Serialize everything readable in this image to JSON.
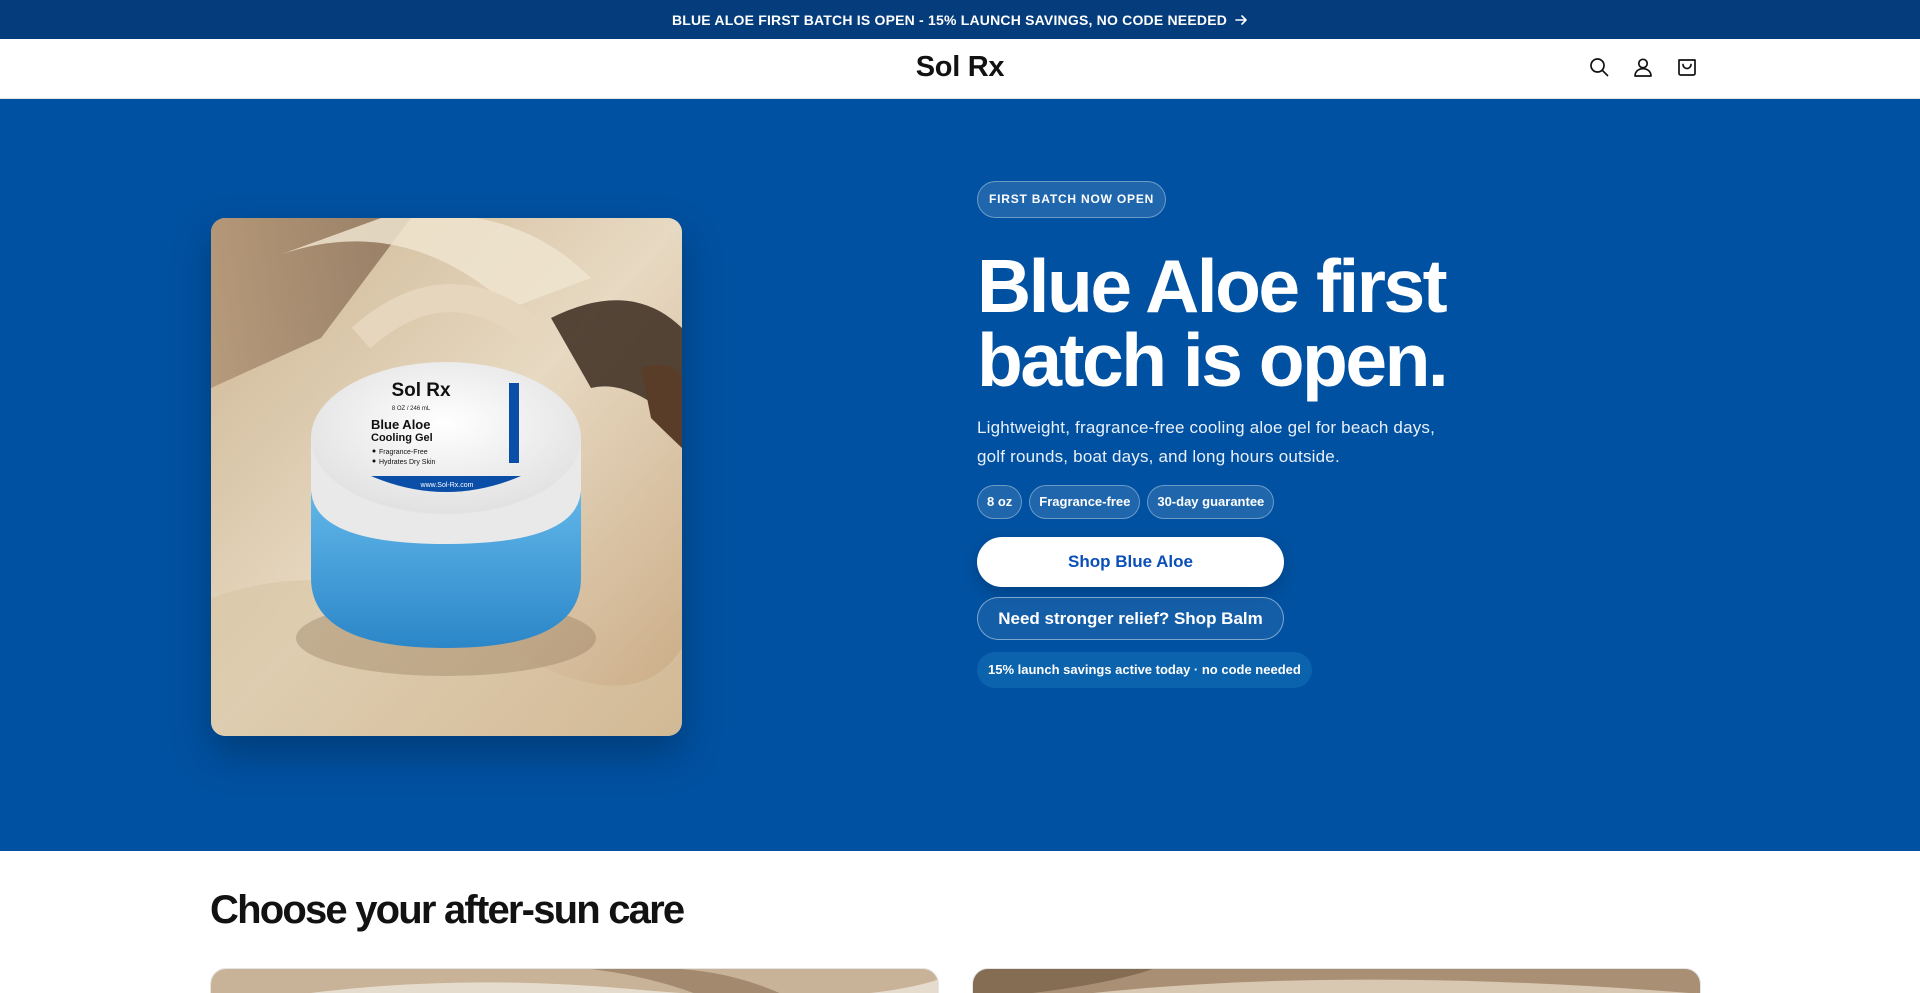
{
  "announcement": {
    "text": "BLUE ALOE FIRST BATCH IS OPEN - 15% LAUNCH SAVINGS, NO CODE NEEDED"
  },
  "header": {
    "logo": "Sol Rx",
    "icons": [
      "search-icon",
      "account-icon",
      "cart-icon"
    ]
  },
  "hero": {
    "eyebrow": "FIRST BATCH NOW OPEN",
    "headline": "Blue Aloe first batch is open.",
    "subtext": "Lightweight, fragrance-free cooling aloe gel for beach days, golf rounds, boat days, and long hours outside.",
    "pills": [
      "8 oz",
      "Fragrance-free",
      "30-day guarantee"
    ],
    "primary_cta": "Shop Blue Aloe",
    "secondary_cta": "Need stronger relief? Shop Balm",
    "savings_note": "15% launch savings active today · no code needed",
    "product_label": {
      "brand": "Sol Rx",
      "size": "8 OZ / 246 mL",
      "name_line1": "Blue Aloe",
      "name_line2": "Cooling Gel",
      "bullet1": "Fragrance-Free",
      "bullet2": "Hydrates Dry Skin",
      "url": "www.Sol-Rx.com"
    }
  },
  "section": {
    "title": "Choose your after-sun care"
  },
  "colors": {
    "announcement_bg": "#053d7c",
    "hero_bg": "#0051a1",
    "primary_button_text": "#0a4fb8"
  }
}
